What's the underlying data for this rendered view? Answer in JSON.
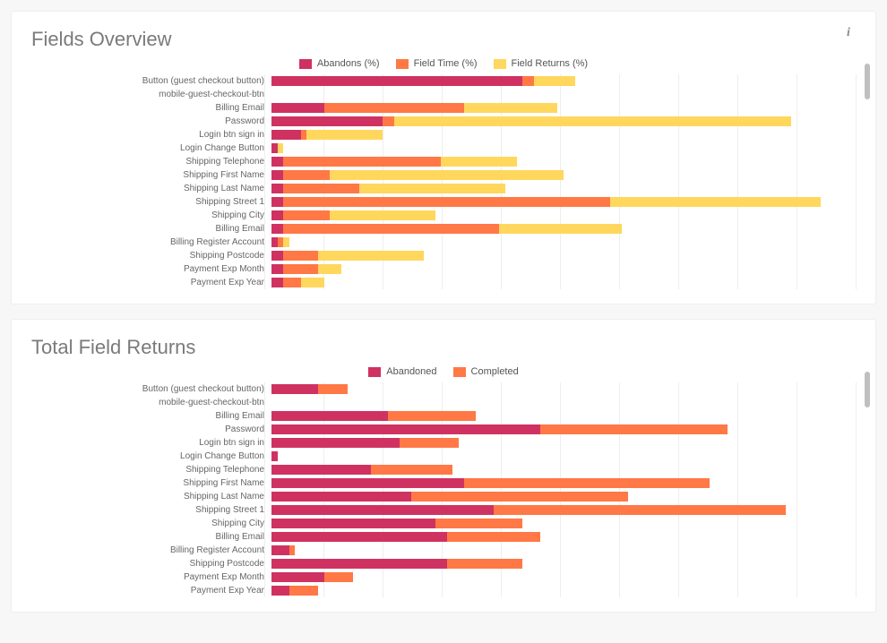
{
  "colors": {
    "abandons": "#cf3261",
    "time": "#ff7846",
    "returns": "#ffd75d",
    "abandoned": "#cf3261",
    "completed": "#ff7846"
  },
  "chart1": {
    "title": "Fields Overview",
    "legend": [
      "Abandons (%)",
      "Field Time (%)",
      "Field Returns (%)"
    ],
    "categories": [
      "Button (guest checkout button)",
      "mobile-guest-checkout-btn",
      "Billing Email",
      "Password",
      "Login btn sign in",
      "Login Change Button",
      "Shipping Telephone",
      "Shipping First Name",
      "Shipping Last Name",
      "Shipping Street 1",
      "Shipping City",
      "Billing Email",
      "Billing Register Account",
      "Shipping  Postcode",
      "Payment Exp Month",
      "Payment Exp Year"
    ]
  },
  "chart2": {
    "title": "Total Field Returns",
    "legend": [
      "Abandoned",
      "Completed"
    ],
    "categories": [
      "Button (guest checkout button)",
      "mobile-guest-checkout-btn",
      "Billing Email",
      "Password",
      "Login btn sign in",
      "Login Change Button",
      "Shipping Telephone",
      "Shipping First Name",
      "Shipping Last Name",
      "Shipping Street 1",
      "Shipping City",
      "Billing Email",
      "Billing Register Account",
      "Shipping  Postcode",
      "Payment Exp Month",
      "Payment Exp Year"
    ]
  },
  "chart_data": [
    {
      "type": "bar",
      "orientation": "horizontal",
      "stacked": true,
      "title": "Fields Overview",
      "xlabel": "",
      "ylabel": "",
      "xlim": [
        0,
        100
      ],
      "categories": [
        "Button (guest checkout button)",
        "mobile-guest-checkout-btn",
        "Billing Email",
        "Password",
        "Login btn sign in",
        "Login Change Button",
        "Shipping Telephone",
        "Shipping First Name",
        "Shipping Last Name",
        "Shipping Street 1",
        "Shipping City",
        "Billing Email",
        "Billing Register Account",
        "Shipping  Postcode",
        "Payment Exp Month",
        "Payment Exp Year"
      ],
      "series": [
        {
          "name": "Abandons (%)",
          "values": [
            43,
            0,
            9,
            19,
            5,
            1,
            2,
            2,
            2,
            2,
            2,
            2,
            1,
            2,
            2,
            2
          ]
        },
        {
          "name": "Field Time (%)",
          "values": [
            2,
            0,
            24,
            2,
            1,
            0,
            27,
            8,
            13,
            56,
            8,
            37,
            1,
            6,
            6,
            3
          ]
        },
        {
          "name": "Field Returns (%)",
          "values": [
            7,
            0,
            16,
            68,
            13,
            1,
            13,
            40,
            25,
            36,
            18,
            21,
            1,
            18,
            4,
            4
          ]
        }
      ],
      "legend_position": "top"
    },
    {
      "type": "bar",
      "orientation": "horizontal",
      "stacked": true,
      "title": "Total Field Returns",
      "xlabel": "",
      "ylabel": "",
      "xlim": [
        0,
        100
      ],
      "categories": [
        "Button (guest checkout button)",
        "mobile-guest-checkout-btn",
        "Billing Email",
        "Password",
        "Login btn sign in",
        "Login Change Button",
        "Shipping Telephone",
        "Shipping First Name",
        "Shipping Last Name",
        "Shipping Street 1",
        "Shipping City",
        "Billing Email",
        "Billing Register Account",
        "Shipping  Postcode",
        "Payment Exp Month",
        "Payment Exp Year"
      ],
      "series": [
        {
          "name": "Abandoned",
          "values": [
            8,
            0,
            20,
            46,
            22,
            1,
            17,
            33,
            24,
            38,
            28,
            30,
            3,
            30,
            9,
            3
          ]
        },
        {
          "name": "Completed",
          "values": [
            5,
            0,
            15,
            32,
            10,
            0,
            14,
            42,
            37,
            50,
            15,
            16,
            1,
            13,
            5,
            5
          ]
        }
      ],
      "legend_position": "top"
    }
  ]
}
